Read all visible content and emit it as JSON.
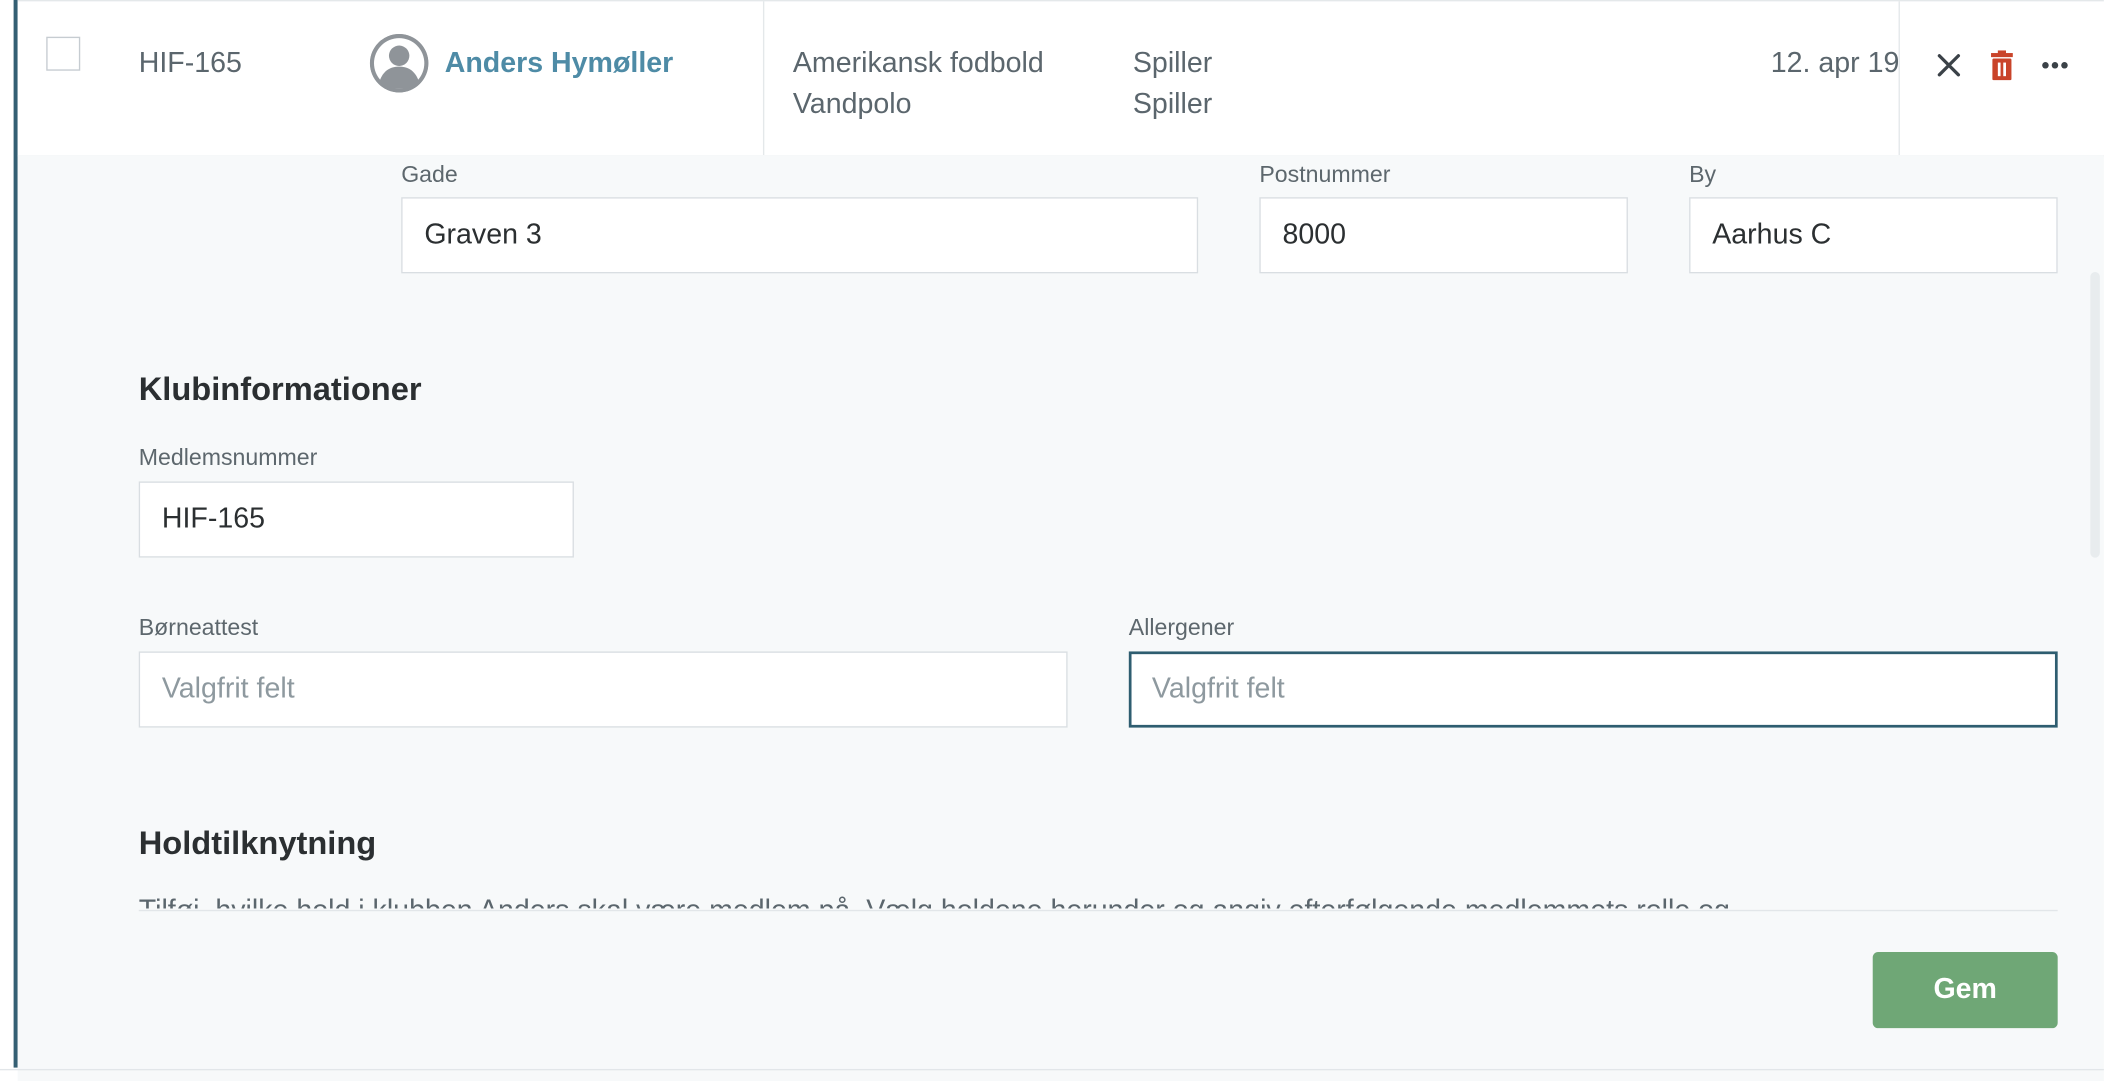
{
  "member_row": {
    "member_id": "HIF-165",
    "name": "Anders Hymøller",
    "sports": [
      "Amerikansk fodbold",
      "Vandpolo"
    ],
    "roles": [
      "Spiller",
      "Spiller"
    ],
    "date": "12. apr 19",
    "icons": {
      "checkbox": "checkbox",
      "avatar": "user-avatar-icon",
      "close": "close-icon",
      "delete": "trash-icon",
      "more": "more-horizontal-icon"
    },
    "colors": {
      "name_link": "#4e8ba6",
      "delete_icon": "#c9442a",
      "accent_bar": "#345f73"
    }
  },
  "address": {
    "street_label": "Gade",
    "street_value": "Graven 3",
    "postal_label": "Postnummer",
    "postal_value": "8000",
    "city_label": "By",
    "city_value": "Aarhus C"
  },
  "club_info": {
    "title": "Klubinformationer",
    "member_number_label": "Medlemsnummer",
    "member_number_value": "HIF-165",
    "child_cert_label": "Børneattest",
    "child_cert_placeholder": "Valgfrit felt",
    "allergies_label": "Allergener",
    "allergies_placeholder": "Valgfrit felt"
  },
  "team_assignment": {
    "title": "Holdtilknytning",
    "description": "Tilføj, hvilke hold i klubben Anders skal være medlem på. Vælg holdene herunder og angiv efterfølgende medlemmets rolle og"
  },
  "save_label": "Gem",
  "save_color": "#6fa776"
}
